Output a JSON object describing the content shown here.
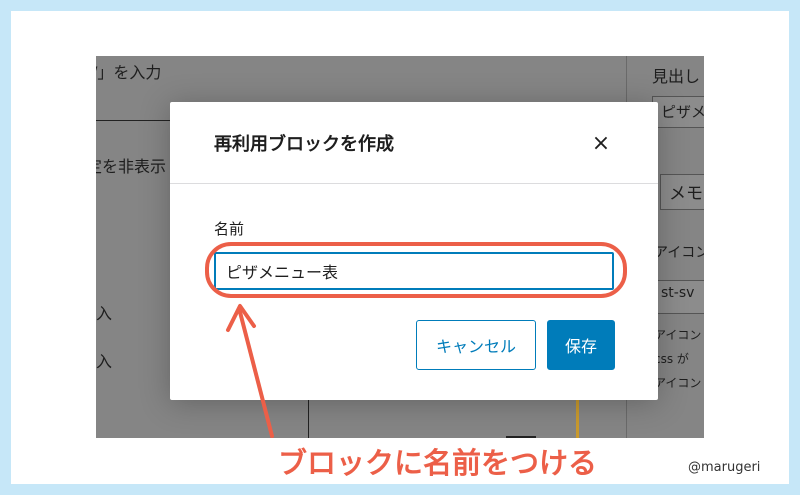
{
  "background": {
    "top_text": "/」を入力",
    "hidden_text": "定を非表示",
    "row1": "入",
    "row2": "入"
  },
  "sidebar": {
    "heading": "見出し",
    "box1": "ピザメ",
    "box2": "メモ",
    "icon_label": "アイコン",
    "icon_input": "st-sv",
    "note1": "アイコン",
    "note2": "css が",
    "note3": "アイコン"
  },
  "modal": {
    "title": "再利用ブロックを作成",
    "close_symbol": "×",
    "name_label": "名前",
    "name_value": "ピザメニュー表",
    "cancel_label": "キャンセル",
    "save_label": "保存"
  },
  "annotation": {
    "text": "ブロックに名前をつける",
    "credit": "@marugeri",
    "color": "#ec5f48"
  },
  "colors": {
    "primary": "#007cba",
    "frame": "#c6e7f8",
    "overlay": "#858585"
  }
}
